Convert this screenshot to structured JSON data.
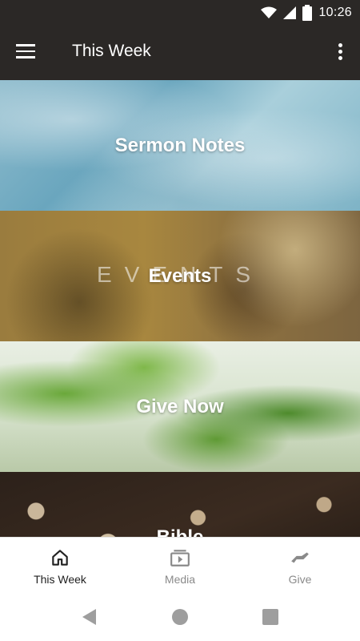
{
  "status_bar": {
    "time": "10:26"
  },
  "app_bar": {
    "title": "This Week"
  },
  "tiles": [
    {
      "label": "Sermon Notes"
    },
    {
      "label": "Events",
      "watermark": "EVENTS"
    },
    {
      "label": "Give Now"
    },
    {
      "label": "Bible"
    }
  ],
  "bottom_nav": {
    "items": [
      {
        "label": "This Week",
        "icon": "home-icon",
        "active": true
      },
      {
        "label": "Media",
        "icon": "media-icon",
        "active": false
      },
      {
        "label": "Give",
        "icon": "give-hand-icon",
        "active": false
      }
    ]
  },
  "colors": {
    "app_bar": "#2b2826",
    "nav_active": "#222222",
    "nav_inactive": "#8a8a8a"
  }
}
